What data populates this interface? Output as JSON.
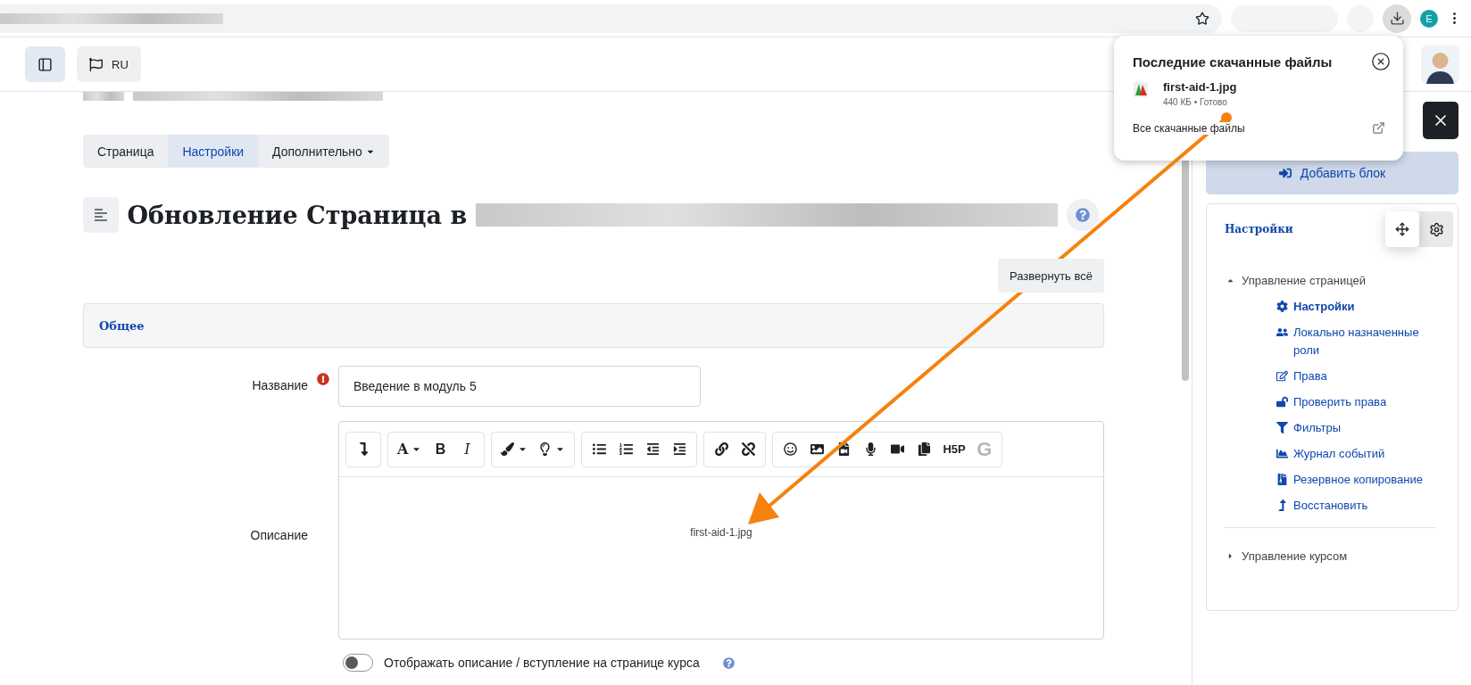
{
  "browser": {
    "profile_initial": "E"
  },
  "navbar": {
    "language": "RU"
  },
  "tabs": [
    {
      "label": "Страница",
      "selected": false,
      "kind": "plain"
    },
    {
      "label": "Настройки",
      "selected": true,
      "kind": "plain"
    },
    {
      "label": "Дополнительно",
      "selected": false,
      "kind": "dropdown"
    }
  ],
  "page_title": "Обновление Страница в",
  "expand_all": "Развернуть всё",
  "section": {
    "title": "Общее"
  },
  "name_field": {
    "label": "Название",
    "value": "Введение в модуль 5",
    "required": true
  },
  "description_field": {
    "label": "Описание",
    "content": "first-aid-1.jpg"
  },
  "toolbar": [
    [
      {
        "kind": "icon"
      }
    ],
    [
      {
        "kind": "text",
        "text": "A",
        "dropdown": true
      },
      {
        "kind": "text",
        "text": "B"
      },
      {
        "kind": "text",
        "text": "I"
      }
    ],
    [
      {
        "kind": "icon",
        "dropdown": true
      },
      {
        "kind": "icon",
        "dropdown": true
      }
    ],
    [
      {
        "kind": "icon"
      },
      {
        "kind": "icon"
      },
      {
        "kind": "icon"
      },
      {
        "kind": "icon"
      }
    ],
    [
      {
        "kind": "icon"
      },
      {
        "kind": "icon"
      }
    ],
    [
      {
        "kind": "icon"
      },
      {
        "kind": "icon"
      },
      {
        "kind": "icon"
      },
      {
        "kind": "icon"
      },
      {
        "kind": "icon"
      },
      {
        "kind": "icon"
      },
      {
        "kind": "text",
        "text": "H5P"
      },
      {
        "kind": "text",
        "text": "G",
        "disabled": true
      }
    ]
  ],
  "show_description": {
    "label": "Отображать описание / вступление на странице курса",
    "on": false
  },
  "downloads": {
    "title": "Последние скачанные файлы",
    "file": {
      "name": "first-aid-1.jpg",
      "meta": "440 КБ • Готово"
    },
    "all_link": "Все скачанные файлы"
  },
  "drawer": {
    "add_block": "Добавить блок",
    "block_title": "Настройки",
    "tree": [
      {
        "label": "Управление страницей",
        "expanded": true,
        "children": [
          {
            "label": "Настройки",
            "selected": true
          },
          {
            "label": "Локально назначенные роли",
            "selected": false
          },
          {
            "label": "Права",
            "selected": false
          },
          {
            "label": "Проверить права",
            "selected": false
          },
          {
            "label": "Фильтры",
            "selected": false
          },
          {
            "label": "Журнал событий",
            "selected": false
          },
          {
            "label": "Резервное копирование",
            "selected": false
          },
          {
            "label": "Восстановить",
            "selected": false
          }
        ]
      },
      {
        "label": "Управление курсом",
        "expanded": false
      }
    ]
  }
}
